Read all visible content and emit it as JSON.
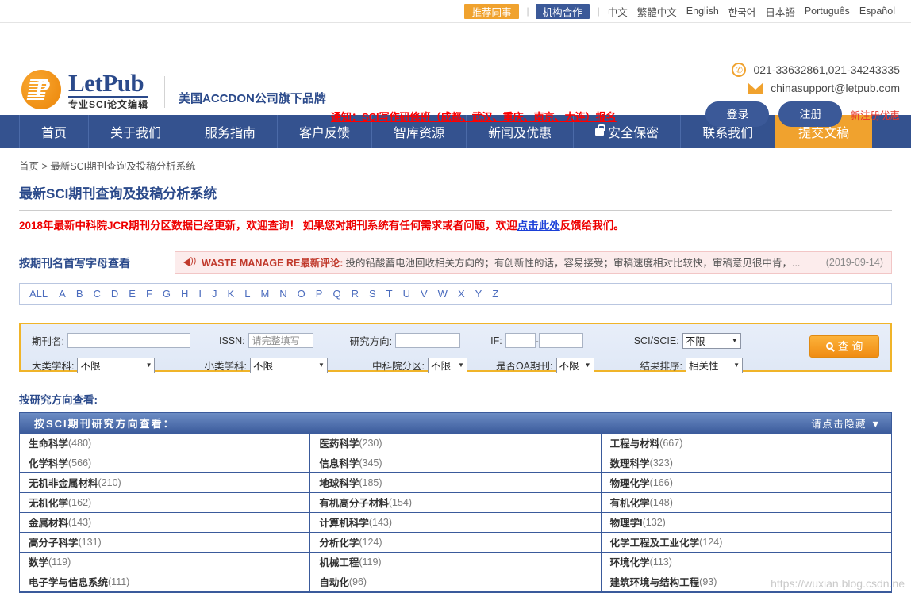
{
  "topbar": {
    "pill_orange": "推荐同事",
    "pill_blue": "机构合作",
    "languages": [
      "中文",
      "繁體中文",
      "English",
      "한국어",
      "日本語",
      "Português",
      "Español"
    ]
  },
  "header": {
    "logo_letter": "P",
    "logo_name": "LetPub",
    "logo_sub": "专业SCI论文编辑",
    "brand_line": "美国ACCDON公司旗下品牌",
    "notice_link": "通知：SCI写作研修班（成都、武汉、重庆、南京、大连）报名",
    "phone": "021-33632861,021-34243335",
    "email": "chinasupport@letpub.com",
    "login_label": "登录",
    "register_label": "注册",
    "new_offer": "新注册优惠"
  },
  "nav": {
    "items": [
      {
        "label": "首页",
        "icon": "",
        "active": false
      },
      {
        "label": "关于我们",
        "icon": "",
        "active": false
      },
      {
        "label": "服务指南",
        "icon": "",
        "active": false
      },
      {
        "label": "客户反馈",
        "icon": "",
        "active": false
      },
      {
        "label": "智库资源",
        "icon": "",
        "active": false
      },
      {
        "label": "新闻及优惠",
        "icon": "",
        "active": false
      },
      {
        "label": "安全保密",
        "icon": "lock-icon",
        "active": false
      },
      {
        "label": "联系我们",
        "icon": "",
        "active": false
      },
      {
        "label": "提交文稿",
        "icon": "",
        "active": true
      }
    ]
  },
  "breadcrumb": {
    "home": "首页",
    "sep": ">",
    "current": "最新SCI期刊查询及投稿分析系统"
  },
  "page": {
    "title": "最新SCI期刊查询及投稿分析系统",
    "notice_part1": "2018年最新中科院JCR期刊分区数据已经更新，欢迎查询！ 如果您对期刊系统有任何需求或者问题，欢迎",
    "notice_link": "点击此处",
    "notice_part2": "反馈给我们。"
  },
  "letter_section": {
    "label": "按期刊名首写字母查看",
    "marquee_title": "WASTE MANAGE RE最新评论:",
    "marquee_body": "投的铅酸蓄电池回收相关方向的；有创新性的话，容易接受；审稿速度相对比较快，审稿意见很中肯，...",
    "marquee_date": "(2019-09-14)",
    "letters": [
      "ALL",
      "A",
      "B",
      "C",
      "D",
      "E",
      "F",
      "G",
      "H",
      "I",
      "J",
      "K",
      "L",
      "M",
      "N",
      "O",
      "P",
      "Q",
      "R",
      "S",
      "T",
      "U",
      "V",
      "W",
      "X",
      "Y",
      "Z"
    ]
  },
  "search_form": {
    "journal_label": "期刊名:",
    "journal_value": "",
    "journal_placeholder": "",
    "issn_label": "ISSN:",
    "issn_value": "",
    "issn_placeholder": "请完整填写",
    "field_label": "研究方向:",
    "field_value": "",
    "if_label": "IF:",
    "if_min": "",
    "if_max": "",
    "if_dash": "-",
    "sci_label": "SCI/SCIE:",
    "sci_value": "不限",
    "major_label": "大类学科:",
    "major_value": "不限",
    "minor_label": "小类学科:",
    "minor_value": "不限",
    "zone_label": "中科院分区:",
    "zone_value": "不限",
    "oa_label": "是否OA期刊:",
    "oa_value": "不限",
    "sort_label": "结果排序:",
    "sort_value": "相关性",
    "search_button": "查 询",
    "search_icon": "magnifier-icon"
  },
  "research": {
    "section_label": "按研究方向查看:",
    "panel_title": "按SCI期刊研究方向查看：",
    "hide_label": "请点击隐藏 ▼",
    "columns": [
      [
        {
          "name": "生命科学",
          "count": "(480)"
        },
        {
          "name": "化学科学",
          "count": "(566)"
        },
        {
          "name": "无机非金属材料",
          "count": "(210)"
        },
        {
          "name": "无机化学",
          "count": "(162)"
        },
        {
          "name": "金属材料",
          "count": "(143)"
        },
        {
          "name": "高分子科学",
          "count": "(131)"
        },
        {
          "name": "数学",
          "count": "(119)"
        },
        {
          "name": "电子学与信息系统",
          "count": "(111)"
        }
      ],
      [
        {
          "name": "医药科学",
          "count": "(230)"
        },
        {
          "name": "信息科学",
          "count": "(345)"
        },
        {
          "name": "地球科学",
          "count": "(185)"
        },
        {
          "name": "有机高分子材料",
          "count": "(154)"
        },
        {
          "name": "计算机科学",
          "count": "(143)"
        },
        {
          "name": "分析化学",
          "count": "(124)"
        },
        {
          "name": "机械工程",
          "count": "(119)"
        },
        {
          "name": "自动化",
          "count": "(96)"
        }
      ],
      [
        {
          "name": "工程与材料",
          "count": "(667)"
        },
        {
          "name": "数理科学",
          "count": "(323)"
        },
        {
          "name": "物理化学",
          "count": "(166)"
        },
        {
          "name": "有机化学",
          "count": "(148)"
        },
        {
          "name": "物理学I",
          "count": "(132)"
        },
        {
          "name": "化学工程及工业化学",
          "count": "(124)"
        },
        {
          "name": "环境化学",
          "count": "(113)"
        },
        {
          "name": "建筑环境与结构工程",
          "count": "(93)"
        }
      ]
    ]
  },
  "watermark": "https://wuxian.blog.csdn.ne"
}
